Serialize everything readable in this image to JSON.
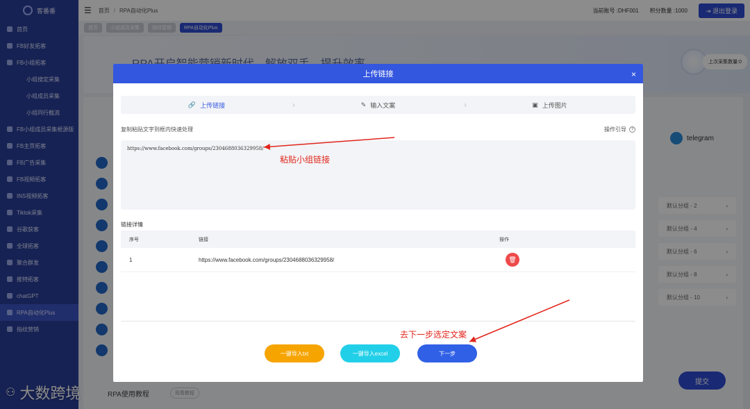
{
  "sidebar": {
    "brand": "客番番",
    "items": [
      {
        "label": "首页",
        "sub": false
      },
      {
        "label": "FB好友拓客",
        "sub": false
      },
      {
        "label": "FB小组拓客",
        "sub": false
      },
      {
        "label": "小组搜定采集",
        "sub": true
      },
      {
        "label": "小组成员采集",
        "sub": true
      },
      {
        "label": "小组同行截流",
        "sub": true
      },
      {
        "label": "FB小组成员采集根源版",
        "sub": false
      },
      {
        "label": "FB主页拓客",
        "sub": false
      },
      {
        "label": "FB广告采集",
        "sub": false
      },
      {
        "label": "FB视频拓客",
        "sub": false
      },
      {
        "label": "INS视频拓客",
        "sub": false
      },
      {
        "label": "Tiktok采集",
        "sub": false
      },
      {
        "label": "谷歌获客",
        "sub": false
      },
      {
        "label": "全球拓客",
        "sub": false
      },
      {
        "label": "聚合群发",
        "sub": false
      },
      {
        "label": "推特拓客",
        "sub": false
      },
      {
        "label": "chatGPT",
        "sub": false
      },
      {
        "label": "RPA自动化Plus",
        "sub": false,
        "active": true
      },
      {
        "label": "指纹营销",
        "sub": false
      }
    ]
  },
  "topbar": {
    "breadcrumb_home": "首页",
    "breadcrumb_current": "RPA自动化Plus",
    "account": "当前账号 :DHF001",
    "points": "积分数量 :1000",
    "logout": "退出登录"
  },
  "tabs": [
    "首页",
    "小组成员采集",
    "指纹营销",
    "RPA自动化Plus"
  ],
  "background": {
    "banner_text": "RPA开启智能营销新时代，解放双手，提升效率",
    "last_count": "上次采集数量:0",
    "telegram": "telegram",
    "groups": [
      "默认分组 - 2",
      "默认分组 - 4",
      "默认分组 - 6",
      "默认分组 - 8",
      "默认分组 - 10"
    ],
    "submit": "提交",
    "rpa_help": "RPA使用教程",
    "rpa_help_pill": "观看教程"
  },
  "modal": {
    "title": "上传链接",
    "close": "×",
    "steps": [
      "上传链接",
      "输入文案",
      "上传图片"
    ],
    "copy_hint": "复制粘贴文字到框内快速处理",
    "guide": "操作引导",
    "link_text": "https://www.facebook.com/groups/2304688036329958/",
    "detail_title": "链接详情",
    "columns": [
      "序号",
      "链接",
      "操作"
    ],
    "rows": [
      {
        "no": "1",
        "link": "https://www.facebook.com/groups/2304688036329958/"
      }
    ],
    "btn_txt": "一键导入txt",
    "btn_excel": "一键导入excel",
    "btn_next": "下一步"
  },
  "annotations": {
    "paste": "粘贴小组链接",
    "next": "去下一步选定文案"
  },
  "watermark": "大数跨境"
}
